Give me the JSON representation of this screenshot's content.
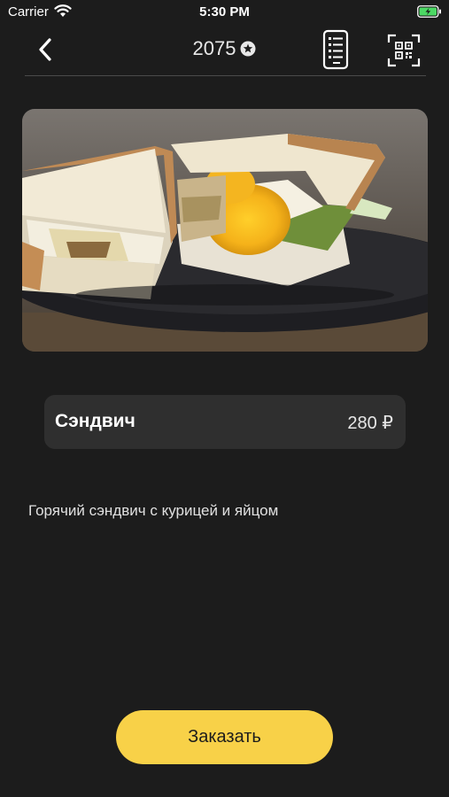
{
  "status_bar": {
    "carrier": "Carrier",
    "time": "5:30 PM",
    "icons": [
      "wifi-icon",
      "battery-charging-icon"
    ]
  },
  "header": {
    "points": "2075",
    "icons": [
      "chevron-left-icon",
      "star-circle-icon",
      "menu-list-icon",
      "qr-scan-icon"
    ]
  },
  "product": {
    "image": "sandwich-photo",
    "name": "Сэндвич",
    "price": "280 ₽",
    "description": "Горячий сэндвич с курицей и яйцом"
  },
  "order_button": {
    "label": "Заказать"
  },
  "colors": {
    "background": "#1c1c1c",
    "card": "#2f2f2f",
    "accent": "#f8d148",
    "battery_green": "#4cd964"
  }
}
